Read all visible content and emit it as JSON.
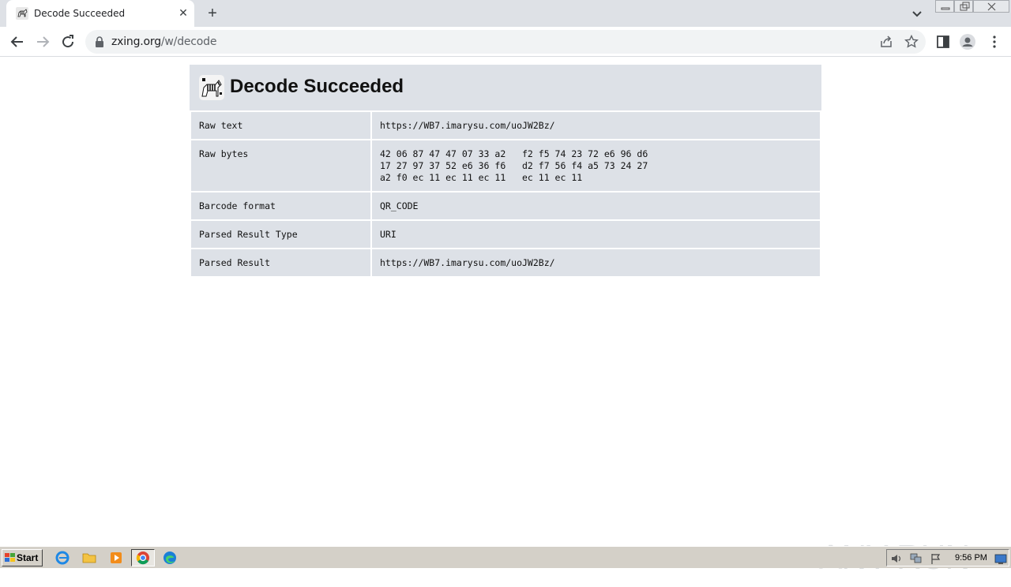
{
  "browser": {
    "tab_title": "Decode Succeeded",
    "tab_close": "✕",
    "new_tab": "+",
    "url_host": "zxing.org",
    "url_path": "/w/decode"
  },
  "page": {
    "heading": "Decode Succeeded",
    "rows": [
      {
        "label": "Raw text",
        "value": "https://WB7.imarysu.com/uoJW2Bz/"
      },
      {
        "label": "Raw bytes",
        "lines": [
          "42 06 87 47 47 07 33 a2   f2 f5 74 23 72 e6 96 d6",
          "17 27 97 37 52 e6 36 f6   d2 f7 56 f4 a5 73 24 27",
          "a2 f0 ec 11 ec 11 ec 11   ec 11 ec 11"
        ]
      },
      {
        "label": "Barcode format",
        "value": "QR_CODE"
      },
      {
        "label": "Parsed Result Type",
        "value": "URI"
      },
      {
        "label": "Parsed Result",
        "value": "https://WB7.imarysu.com/uoJW2Bz/"
      }
    ]
  },
  "watermark": {
    "text": "ANY RUN"
  },
  "taskbar": {
    "start_label": "Start",
    "clock": "9:56 PM"
  }
}
